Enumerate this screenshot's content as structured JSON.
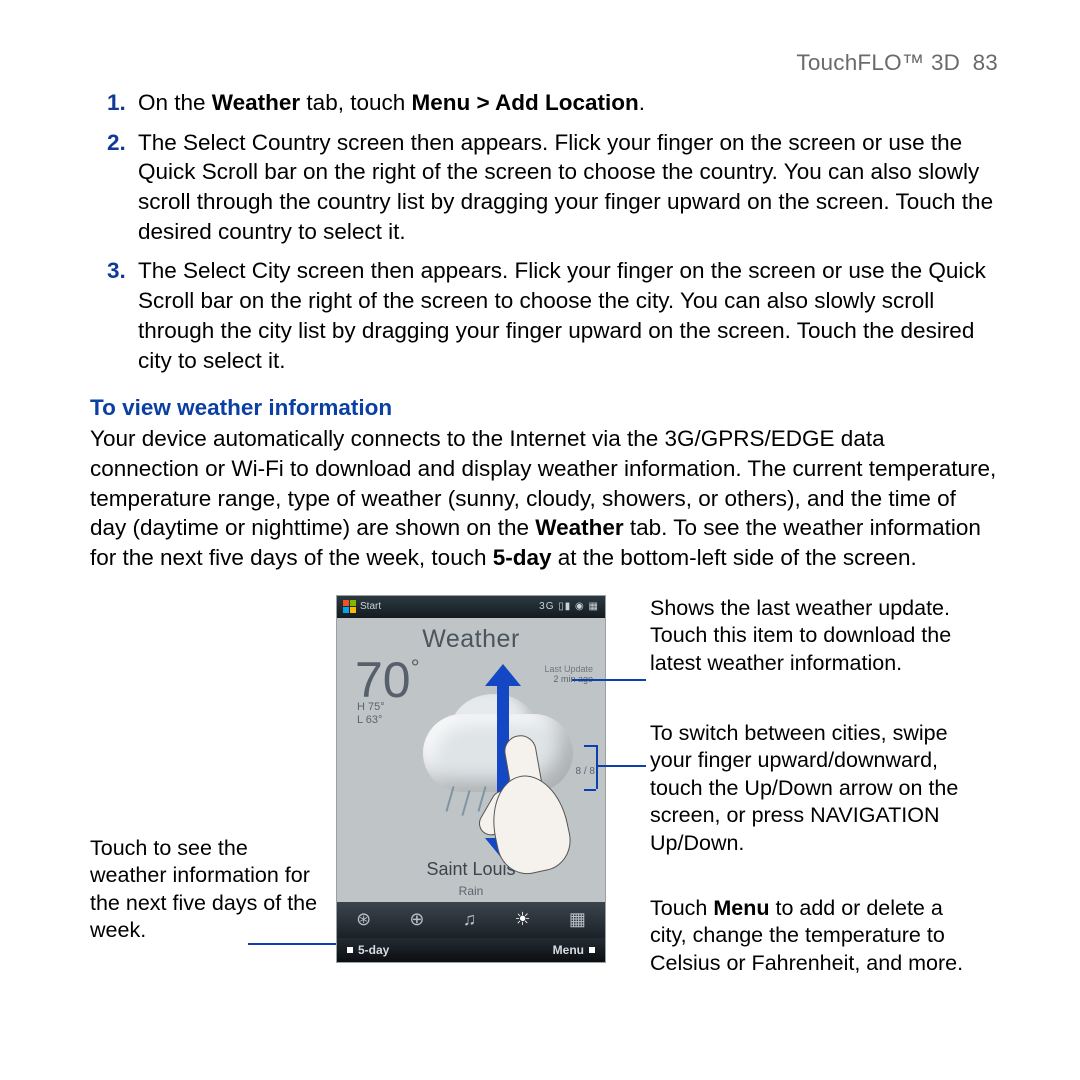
{
  "header": {
    "title": "TouchFLO™ 3D",
    "page": "83"
  },
  "steps": {
    "s1_pre": "On the ",
    "s1_b1": "Weather",
    "s1_mid": " tab, touch ",
    "s1_b2": "Menu > Add Location",
    "s1_post": ".",
    "s2": "The Select Country screen then appears. Flick your finger on the screen or use the Quick Scroll bar on the right of the screen to choose the country. You can also slowly scroll through the country list by dragging your finger upward on the screen. Touch the desired country to select it.",
    "s3": "The Select City screen then appears. Flick your finger on the screen or use the Quick Scroll bar on the right of the screen to choose the city. You can also slowly scroll through the city list by dragging your finger upward on the screen. Touch the desired city to select it."
  },
  "section_heading": "To view weather information",
  "body": {
    "p1a": "Your device automatically connects to the Internet via the 3G/GPRS/EDGE data connection or Wi-Fi to download and display weather information. The current temperature, temperature range, type of weather (sunny, cloudy, showers, or others), and the time of day (daytime or nighttime) are shown on the ",
    "p1b": "Weather",
    "p1c": " tab. To see the weather information for the next five days of the week, touch ",
    "p1d": "5-day",
    "p1e": " at the bottom-left side of the screen."
  },
  "callouts": {
    "left1": "Touch to see the weather information for the next five days of the week.",
    "right1": "Shows the last weather update. Touch this item to download the latest weather information.",
    "right2": "To switch between cities, swipe your finger upward/downward, touch the Up/Down arrow on the screen, or press NAVIGATION Up/Down.",
    "right3a": "Touch ",
    "right3b": "Menu",
    "right3c": " to add or delete a city, change the temperature to Celsius or Fahrenheit, and more."
  },
  "phone": {
    "start": "Start",
    "status_icons": "3G ▯▮ ◉ ▦",
    "title": "Weather",
    "temp": "70",
    "deg": "°",
    "last_update_lbl": "Last Update",
    "last_update_val": "2 min ago",
    "hi": "H 75°",
    "lo": "L 63°",
    "city": "Saint Louis",
    "cond": "Rain",
    "counter": "8 / 8",
    "bottom_left": "5-day",
    "bottom_right": "Menu",
    "tabs": {
      "t1": "⊛",
      "t2": "⊕",
      "t3": "♫",
      "t4": "☀",
      "t5": "▦"
    }
  }
}
